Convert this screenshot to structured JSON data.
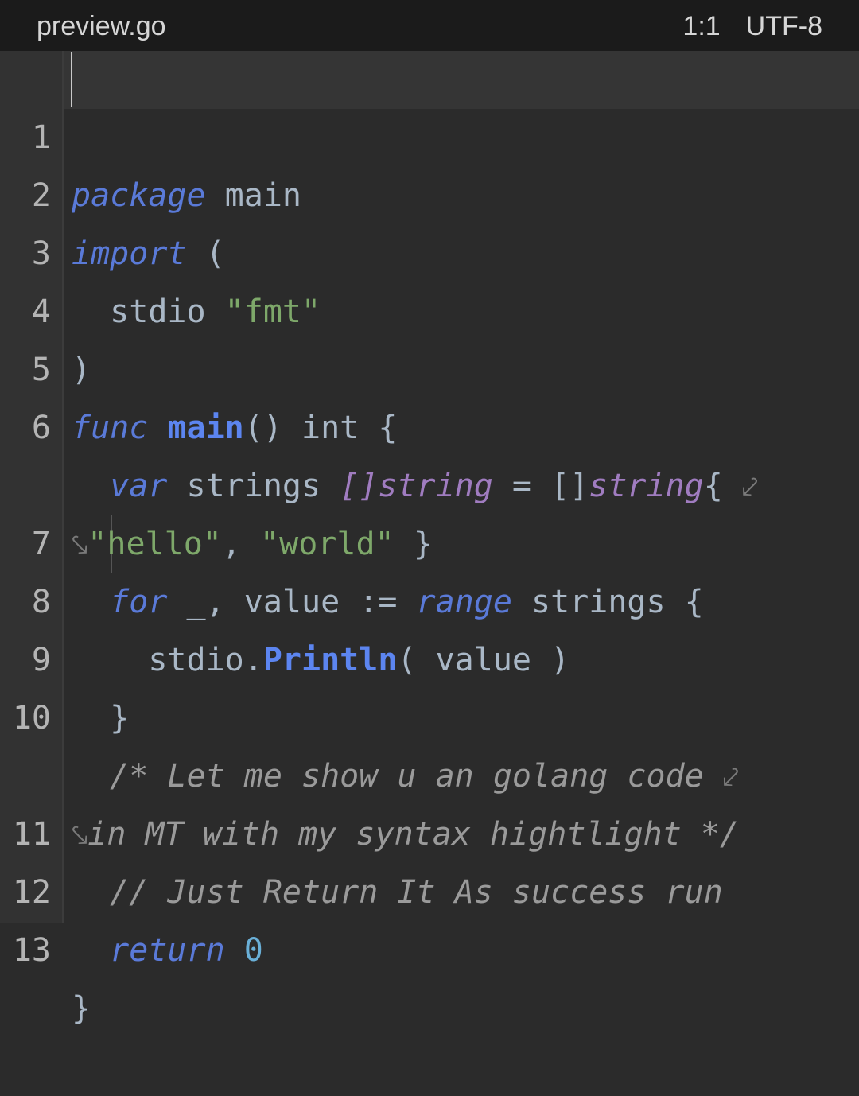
{
  "tab": {
    "title": "preview.go"
  },
  "status": {
    "cursor": "1:1",
    "encoding": "UTF-8"
  },
  "lines": [
    {
      "num": "1"
    },
    {
      "num": "2"
    },
    {
      "num": "3"
    },
    {
      "num": "4"
    },
    {
      "num": "5"
    },
    {
      "num": "6"
    },
    {
      "num": ""
    },
    {
      "num": "7"
    },
    {
      "num": "8"
    },
    {
      "num": "9"
    },
    {
      "num": "10"
    },
    {
      "num": ""
    },
    {
      "num": "11"
    },
    {
      "num": "12"
    },
    {
      "num": "13"
    }
  ],
  "code": {
    "l1": {
      "kw": "package",
      "rest": " main"
    },
    "l2": {
      "kw": "import",
      "rest": " ("
    },
    "l3": {
      "ident": "  stdio ",
      "str": "\"fmt\""
    },
    "l4": {
      "rest": ")"
    },
    "l5": {
      "kw": "func",
      "sp": " ",
      "fn": "main",
      "rest": "() int {"
    },
    "l6": {
      "indent": "  ",
      "kw": "var",
      "ident": " strings ",
      "type1": "[]string",
      "eq": " = []",
      "type2": "string",
      "brace": "{ ",
      "wrap": "⤦"
    },
    "l6b": {
      "wrap": "⤥",
      "s1": "\"hello\"",
      "comma": ", ",
      "s2": "\"world\"",
      "end": " }"
    },
    "l7": {
      "indent": "  ",
      "kw": "for",
      "mid": " _, value := ",
      "kw2": "range",
      "rest": " strings {"
    },
    "l8": {
      "indent": "    stdio.",
      "fn": "Println",
      "rest": "( value )"
    },
    "l9": {
      "rest": "  }"
    },
    "l10": {
      "indent": "  ",
      "cmt": "/* Let me show u an golang code ",
      "wrap": "⤦"
    },
    "l10b": {
      "wrap": "⤥",
      "cmt": "in MT with my syntax hightlight */"
    },
    "l11": {
      "indent": "  ",
      "cmt": "// Just Return It As success run"
    },
    "l12": {
      "indent": "  ",
      "kw": "return",
      "sp": " ",
      "num": "0"
    },
    "l13": {
      "rest": "}"
    }
  }
}
